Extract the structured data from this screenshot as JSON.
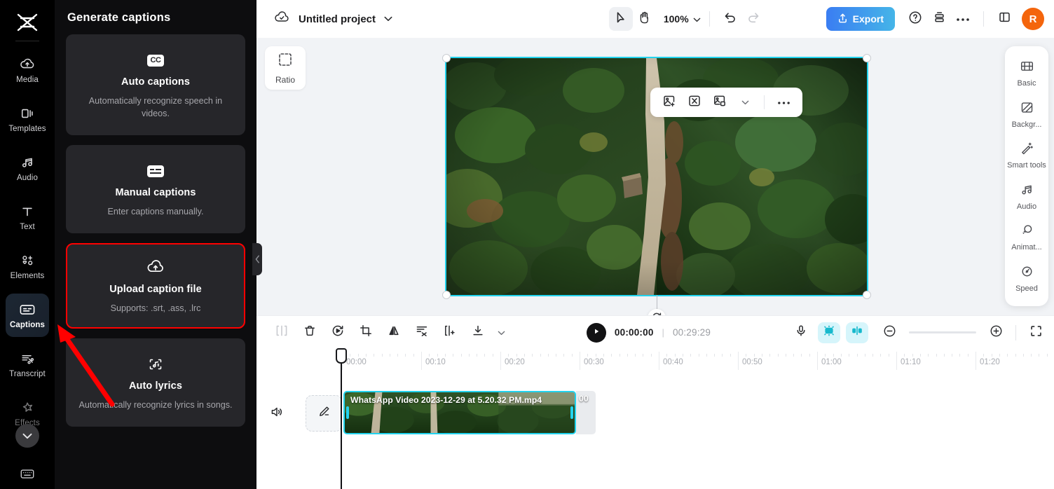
{
  "app": {
    "name": "CapCut",
    "logo_icon": "capcut-logo-icon"
  },
  "rail": {
    "items": [
      {
        "label": "Media",
        "icon": "media-cloud-icon",
        "active": false
      },
      {
        "label": "Templates",
        "icon": "templates-icon",
        "active": false
      },
      {
        "label": "Audio",
        "icon": "audio-note-icon",
        "active": false
      },
      {
        "label": "Text",
        "icon": "text-t-icon",
        "active": false
      },
      {
        "label": "Elements",
        "icon": "elements-icon",
        "active": false
      },
      {
        "label": "Captions",
        "icon": "captions-cc-icon",
        "active": true
      },
      {
        "label": "Transcript",
        "icon": "transcript-icon",
        "active": false
      },
      {
        "label": "Effects",
        "icon": "effects-star-icon",
        "active": false
      }
    ],
    "expand_icon": "chevron-down-icon",
    "bottom_icon": "keyboard-shortcuts-icon"
  },
  "panel": {
    "title": "Generate captions",
    "collapse_icon": "chevron-left-icon",
    "cards": [
      {
        "title": "Auto captions",
        "desc": "Automatically recognize speech in videos.",
        "icon": "cc-icon",
        "highlighted": false
      },
      {
        "title": "Manual captions",
        "desc": "Enter captions manually.",
        "icon": "manual-caption-icon",
        "highlighted": false
      },
      {
        "title": "Upload caption file",
        "desc": "Supports: .srt, .ass, .lrc",
        "icon": "upload-cloud-icon",
        "highlighted": true
      },
      {
        "title": "Auto lyrics",
        "desc": "Automatically recognize lyrics in songs.",
        "icon": "auto-lyrics-icon",
        "highlighted": false
      }
    ],
    "annotation": {
      "type": "red-arrow",
      "color": "#ff0000",
      "points_to": "Captions"
    }
  },
  "topbar": {
    "cloud_icon": "cloud-check-icon",
    "project_name": "Untitled project",
    "project_dropdown_icon": "chevron-down-icon",
    "select_tool_icon": "cursor-arrow-icon",
    "hand_tool_icon": "hand-icon",
    "zoom_level": "100%",
    "zoom_dropdown_icon": "chevron-down-icon",
    "undo_icon": "undo-icon",
    "redo_icon": "redo-icon",
    "export_label": "Export",
    "export_icon": "export-upload-icon",
    "help_icon": "help-circle-icon",
    "layout_icon": "stack-icon",
    "more_icon": "more-dots-icon",
    "split_view_icon": "split-panel-icon",
    "avatar_initial": "R"
  },
  "stage": {
    "ratio_label": "Ratio",
    "ratio_icon": "ratio-dashed-square-icon",
    "float_tools": [
      {
        "icon": "add-image-icon"
      },
      {
        "icon": "fit-to-frame-icon"
      },
      {
        "icon": "pip-overlay-icon"
      },
      {
        "icon": "chevron-down-icon"
      },
      {
        "icon": "more-dots-icon"
      }
    ],
    "rotate_icon": "rotate-handle-icon",
    "selection_color": "#22d3ee"
  },
  "dock": {
    "items": [
      {
        "label": "Basic",
        "icon": "film-strip-icon"
      },
      {
        "label": "Backgr...",
        "icon": "background-icon"
      },
      {
        "label": "Smart tools",
        "icon": "magic-wand-icon"
      },
      {
        "label": "Audio",
        "icon": "audio-note-icon"
      },
      {
        "label": "Animat...",
        "icon": "animation-icon"
      },
      {
        "label": "Speed",
        "icon": "speedometer-icon"
      }
    ]
  },
  "timeline_toolbar": {
    "tools": [
      {
        "icon": "split-icon"
      },
      {
        "icon": "delete-trash-icon"
      },
      {
        "icon": "reverse-icon"
      },
      {
        "icon": "crop-icon"
      },
      {
        "icon": "mirror-flip-icon"
      },
      {
        "icon": "remove-background-cut-icon"
      },
      {
        "icon": "freeze-frame-icon"
      },
      {
        "icon": "download-icon"
      },
      {
        "icon": "chevron-down-icon"
      }
    ],
    "play_icon": "play-icon",
    "current_time": "00:00:00",
    "time_separator": "|",
    "total_time": "00:29:29",
    "mic_icon": "microphone-icon",
    "auto_captions_chip_icon": "auto-captions-chip-icon",
    "audio_split_chip_icon": "audio-split-chip-icon",
    "zoom_out_icon": "minus-circle-icon",
    "zoom_in_icon": "plus-circle-icon",
    "fit_icon": "fit-timeline-icon"
  },
  "timeline": {
    "ruler_ticks": [
      "00:00",
      "00:10",
      "00:20",
      "00:30",
      "00:40",
      "00:50",
      "01:00",
      "01:10",
      "01:20"
    ],
    "playhead_time": "00:00",
    "track": {
      "mute_icon": "speaker-icon",
      "edit_icon": "pencil-edit-icon",
      "clip_name": "WhatsApp Video 2023-12-29 at 5.20.32 PM.mp4",
      "clip_name_overflow": "00",
      "clip_selected": true
    }
  }
}
